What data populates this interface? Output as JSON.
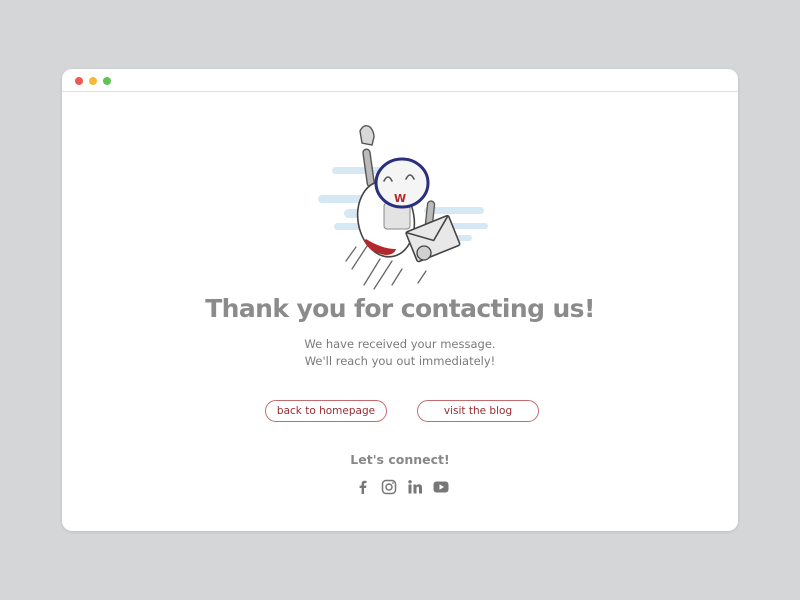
{
  "window": {
    "controls": [
      "close",
      "minimize",
      "maximize"
    ]
  },
  "illustration": {
    "name": "robot-with-envelope",
    "badge_letter": "W"
  },
  "heading": "Thank you for contacting us!",
  "message": {
    "line1": "We have received your message.",
    "line2": "We'll reach you out immediately!"
  },
  "buttons": {
    "home": "back to homepage",
    "blog": "visit the blog"
  },
  "connect": {
    "title": "Let's connect!",
    "icons": [
      "facebook-icon",
      "instagram-icon",
      "linkedin-icon",
      "youtube-icon"
    ]
  },
  "colors": {
    "background": "#d5d6d8",
    "heading": "#8b8b8b",
    "accent": "#9a2b33",
    "robot_visor": "#2a2f7d",
    "speed_lines": "#d7e8f5"
  }
}
